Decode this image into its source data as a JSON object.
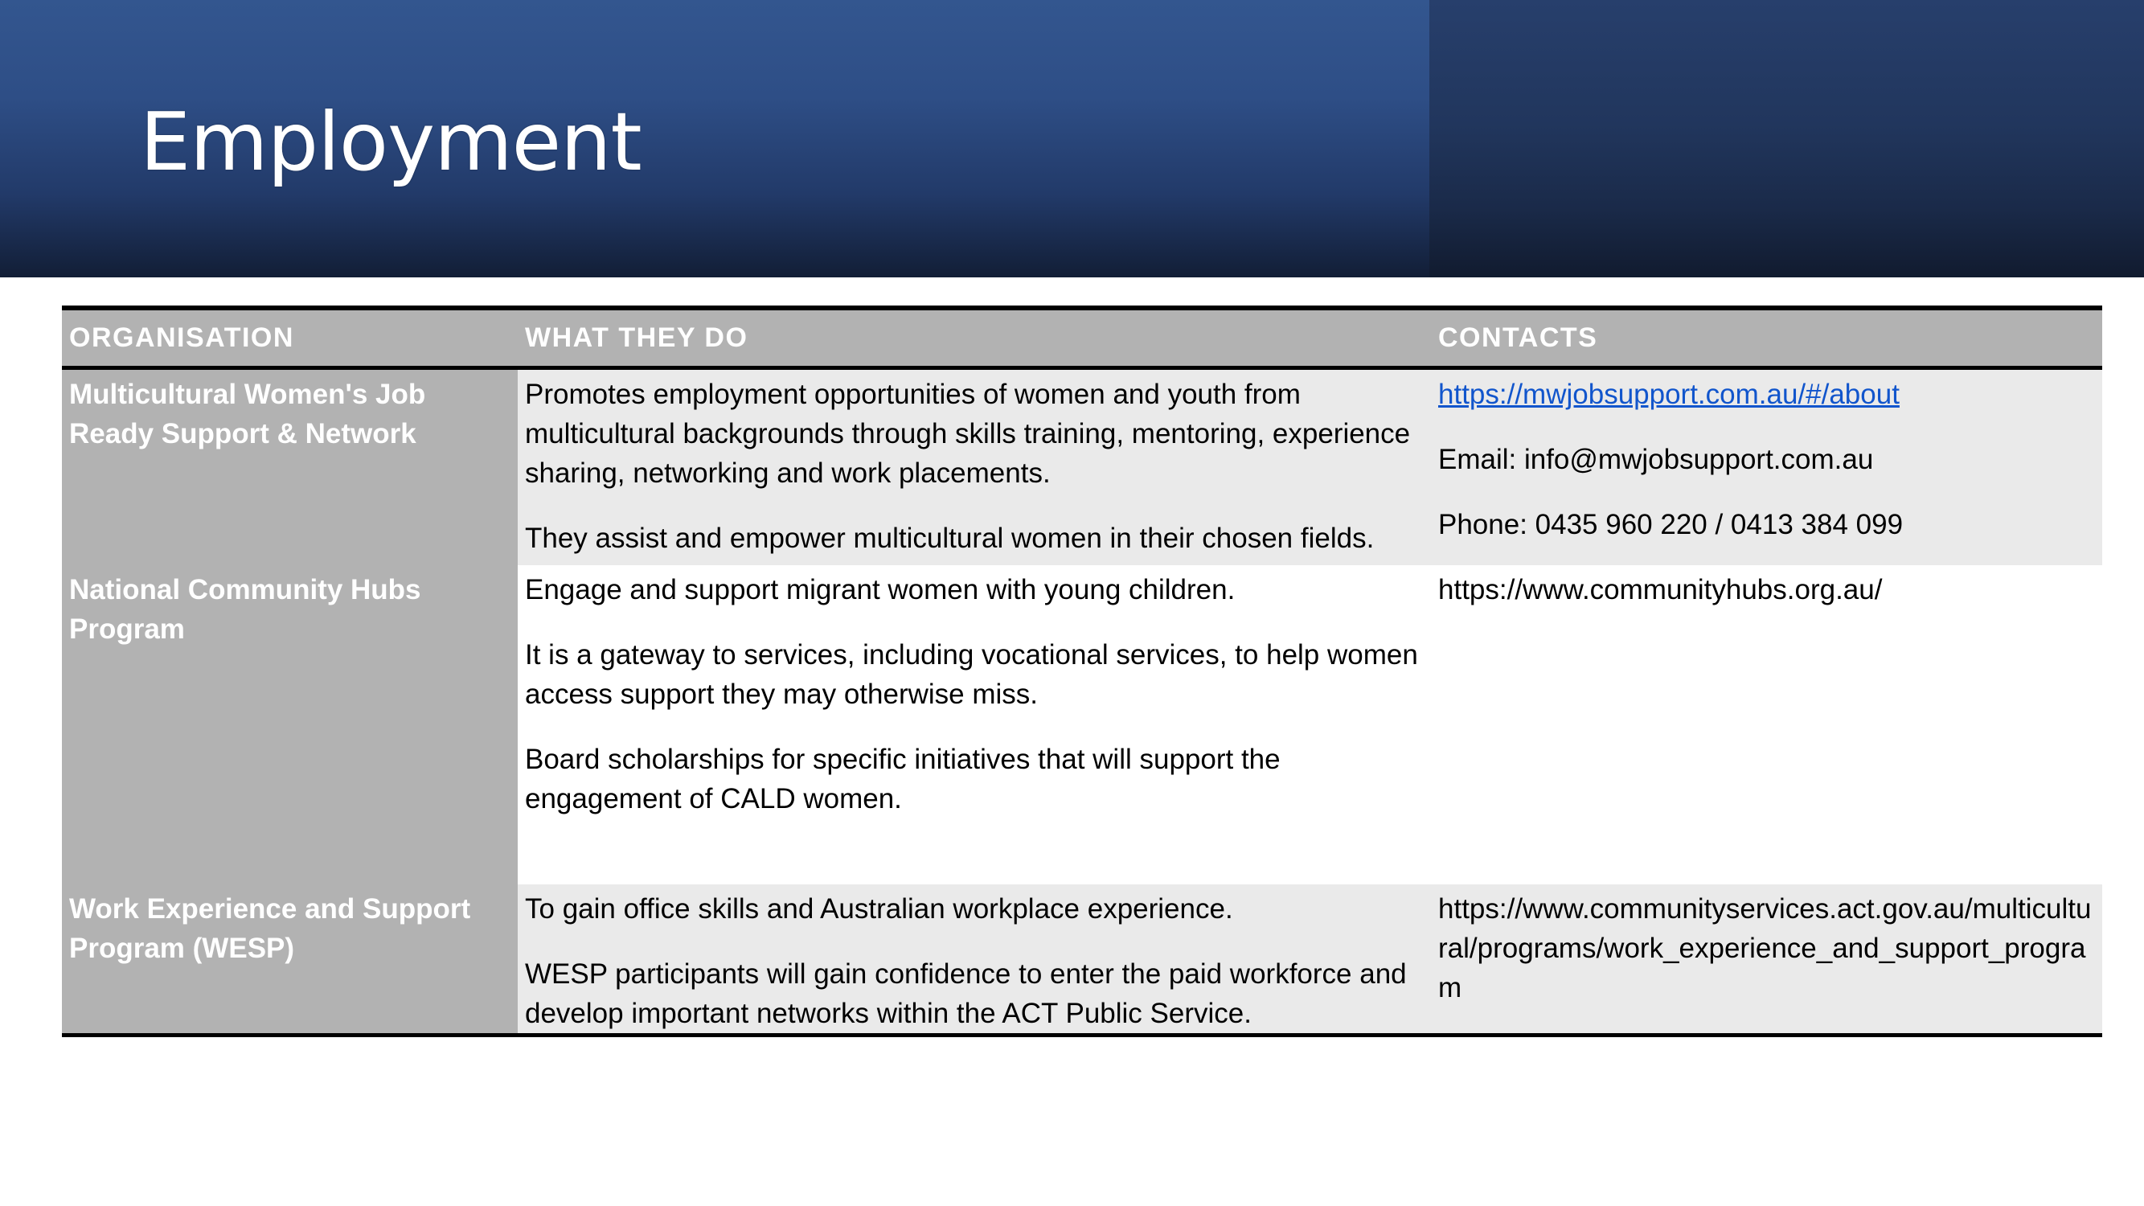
{
  "slide": {
    "title": "Employment"
  },
  "table": {
    "headers": {
      "organisation": "ORGANISATION",
      "what_they_do": "WHAT THEY DO",
      "contacts": "CONTACTS"
    },
    "rows": [
      {
        "organisation": "Multicultural Women's Job Ready Support & Network",
        "what_they_do": [
          "Promotes employment opportunities of women and youth from multicultural backgrounds through skills training, mentoring, experience sharing, networking and work placements.",
          "They assist and empower multicultural women in their chosen fields."
        ],
        "contacts": {
          "link": "https://mwjobsupport.com.au/#/about",
          "email": "Email: info@mwjobsupport.com.au",
          "phone": "Phone: 0435 960 220 / 0413 384 099"
        }
      },
      {
        "organisation": "National Community Hubs Program",
        "what_they_do": [
          "Engage and support migrant women with young children.",
          "It is a gateway to services, including vocational services, to help women access support they may otherwise miss.",
          "Board scholarships for specific initiatives that will support the engagement of CALD women."
        ],
        "contacts": {
          "url": "https://www.communityhubs.org.au/"
        }
      },
      {
        "organisation": "Work Experience and Support Program (WESP)",
        "what_they_do": [
          "To gain office skills and Australian workplace experience.",
          "WESP participants will gain confidence to enter the paid workforce and develop important networks within the ACT Public Service."
        ],
        "contacts": {
          "url": "https://www.communityservices.act.gov.au/multicultural/programs/work_experience_and_support_program"
        }
      }
    ]
  },
  "colors": {
    "banner_blue": "#2e4e86",
    "banner_dark": "#1a2a49",
    "org_cell_grey": "#b2b2b2",
    "band_grey": "#eaeaea",
    "link_blue": "#1155cc"
  }
}
